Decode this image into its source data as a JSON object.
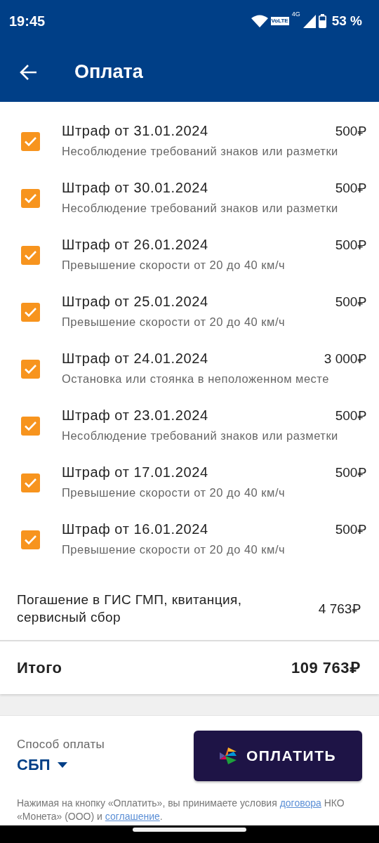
{
  "status_bar": {
    "time": "19:45",
    "network_badge": "VoLTE",
    "network_type": "4G",
    "battery": "53 %"
  },
  "header": {
    "title": "Оплата"
  },
  "fines": [
    {
      "title": "Штраф от 31.01.2024",
      "amount": "500₽",
      "description": "Несоблюдение требований знаков или разметки",
      "checked": true
    },
    {
      "title": "Штраф от 30.01.2024",
      "amount": "500₽",
      "description": "Несоблюдение требований знаков или разметки",
      "checked": true
    },
    {
      "title": "Штраф от 26.01.2024",
      "amount": "500₽",
      "description": "Превышение скорости от 20 до 40 км/ч",
      "checked": true
    },
    {
      "title": "Штраф от 25.01.2024",
      "amount": "500₽",
      "description": "Превышение скорости от 20 до 40 км/ч",
      "checked": true
    },
    {
      "title": "Штраф от 24.01.2024",
      "amount": "3 000₽",
      "description": "Остановка или стоянка в неположенном месте",
      "checked": true
    },
    {
      "title": "Штраф от 23.01.2024",
      "amount": "500₽",
      "description": "Несоблюдение требований знаков или разметки",
      "checked": true
    },
    {
      "title": "Штраф от 17.01.2024",
      "amount": "500₽",
      "description": "Превышение скорости от 20 до 40 км/ч",
      "checked": true
    },
    {
      "title": "Штраф от 16.01.2024",
      "amount": "500₽",
      "description": "Превышение скорости от 20 до 40 км/ч",
      "checked": true
    }
  ],
  "fee": {
    "label": "Погашение в ГИС ГМП, квитанция, сервисный сбор",
    "amount": "4 763₽"
  },
  "total": {
    "label": "Итого",
    "amount": "109 763₽"
  },
  "payment": {
    "method_label": "Способ оплаты",
    "method": "СБП",
    "pay_button": "ОПЛАТИТЬ",
    "disclaimer": [
      "Нажимая на кнопку «Оплатить», вы принимаете условия ",
      {
        "link": "договора"
      },
      " НКО «Монета» (ООО) и ",
      {
        "link": "соглашение"
      },
      "."
    ]
  }
}
